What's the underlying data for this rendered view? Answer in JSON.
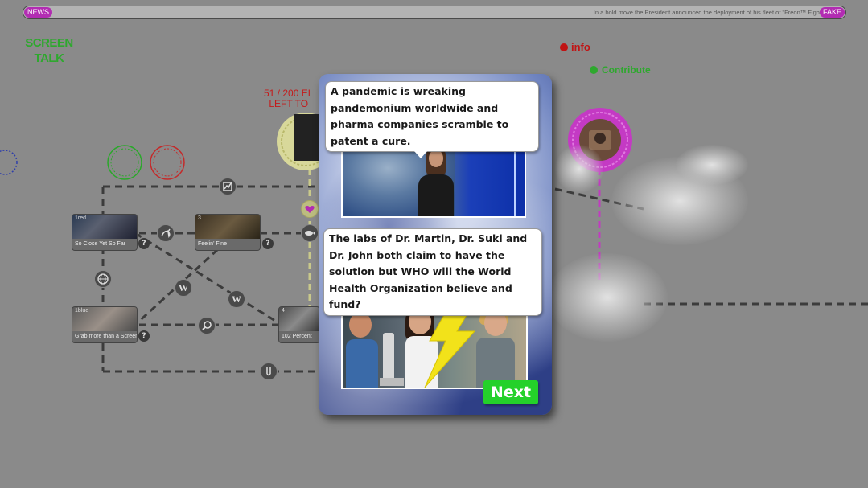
{
  "ticker": {
    "news_label": "NEWS",
    "headline": "In a bold move the President announced the deployment of his fleet of \"Freon™ Fight",
    "fake_label": "FAKE"
  },
  "brand": {
    "line1": "SCREEN",
    "line2": "TALK"
  },
  "header_links": {
    "info": "info",
    "contribute": "Contribute"
  },
  "counter": {
    "line1": "51 / 200 EL",
    "line2": "LEFT TO"
  },
  "nodes": [
    {
      "num": "1red",
      "label": "So Close Yet So Far"
    },
    {
      "num": "3",
      "label": "Feelin' Fine"
    },
    {
      "num": "1blue",
      "label": "Grab more than a Screen"
    },
    {
      "num": "4",
      "label": "102 Percent"
    }
  ],
  "hub_icons": {
    "chart": "chart-icon",
    "globe": "globe-icon",
    "wiki": "W",
    "wu": "W",
    "search": "search-icon",
    "rabbit": "rabbit-icon",
    "heart": "heart-icon",
    "fish": "fish-icon",
    "gesture": "gesture-icon"
  },
  "modal": {
    "bubble1": "A pandemic is wreaking pandemonium worldwide and pharma companies scramble to patent a cure.",
    "bubble2": "The labs of Dr. Martin, Dr. Suki and Dr. John both claim to have the solution but WHO will the World Health Organization believe and fund?",
    "next_label": "Next"
  },
  "colors": {
    "background": "#8a8a8a",
    "brand_green": "#2ea82e",
    "info_red": "#c01414",
    "accent_magenta": "#b22cb2",
    "next_green": "#24d12a",
    "lightning": "#f2e21a"
  }
}
